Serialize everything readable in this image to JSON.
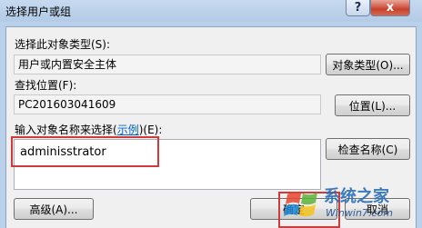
{
  "window": {
    "title": "选择用户或组",
    "help_label": "?",
    "close_label": "x"
  },
  "object_type": {
    "label": "选择此对象类型(S):",
    "value": "用户或内置安全主体",
    "button": "对象类型(O)..."
  },
  "location": {
    "label": "查找位置(F):",
    "value": "PC201603041609",
    "button": "位置(L)..."
  },
  "names": {
    "label_prefix": "输入对象名称来选择(",
    "label_link": "示例",
    "label_suffix": ")(E):",
    "value": "adminisstrator",
    "check_button": "检查名称(C)"
  },
  "footer": {
    "advanced_button": "高级(A)...",
    "ok_button": "确定",
    "cancel_button": "取消"
  },
  "watermark": {
    "text": "系统之家",
    "url": "Winwin7.com"
  },
  "colors": {
    "highlight": "#d23a3a",
    "link": "#0066cc",
    "window_frame": "#b9d1ea"
  }
}
